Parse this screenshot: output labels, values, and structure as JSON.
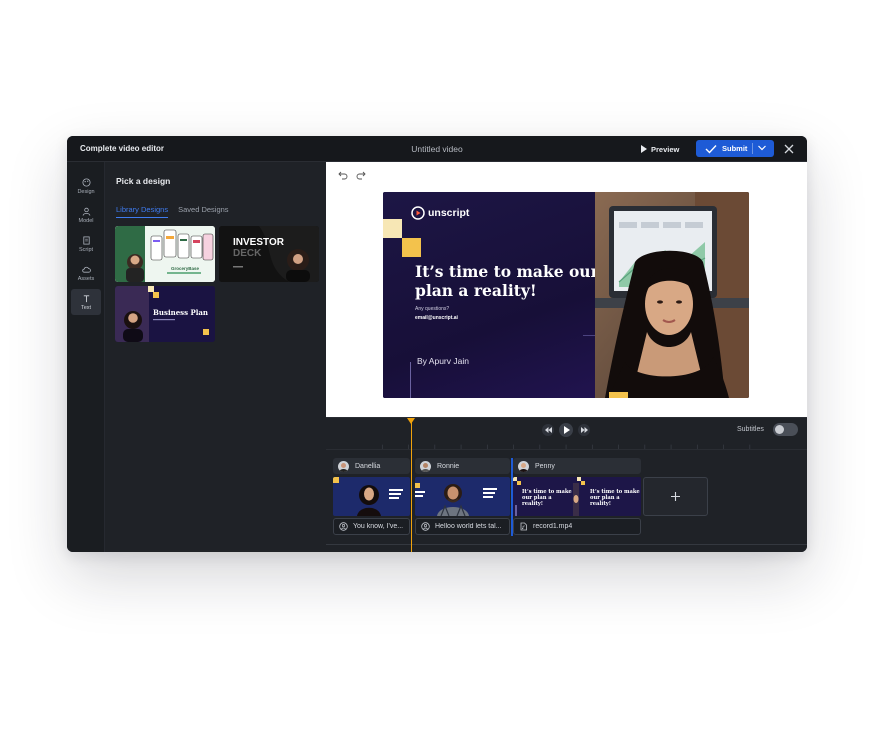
{
  "topbar": {
    "app_title": "Complete video editor",
    "doc_title": "Untitled video",
    "preview_label": "Preview",
    "submit_label": "Submit"
  },
  "rail": {
    "items": [
      {
        "label": "Design",
        "icon": "palette-icon"
      },
      {
        "label": "Model",
        "icon": "person-icon"
      },
      {
        "label": "Script",
        "icon": "document-icon"
      },
      {
        "label": "Assets",
        "icon": "cloud-icon"
      },
      {
        "label": "Text",
        "icon": "text-icon"
      }
    ],
    "active": "Text"
  },
  "panel": {
    "heading": "Pick a design",
    "tabs": [
      "Library Designs",
      "Saved Designs"
    ],
    "active_tab": "Library Designs",
    "thumbs": [
      {
        "title": "GroceryBase"
      },
      {
        "title": "INVESTOR",
        "title2": "DECK"
      },
      {
        "title": "Business Plan"
      }
    ]
  },
  "slide": {
    "brand": "unscript",
    "headline": "It’s time to make our plan a reality!",
    "question": "Any questions?",
    "email": "email@unscript.ai",
    "author": "By Apurv Jain",
    "mini_headline": "It’s time to make our plan a reality!"
  },
  "timeline": {
    "subtitles_label": "Subtitles",
    "tracks": [
      {
        "name": "Danellia",
        "audio": "You know, I've..."
      },
      {
        "name": "Ronnie",
        "audio": "Helloo world lets tal..."
      },
      {
        "name": "Penny",
        "audio": "record1.mp4"
      }
    ]
  },
  "colors": {
    "accent": "#1e5bd6",
    "playhead": "#f0a20c",
    "slide_bg": "#18123a",
    "slide_gold": "#f3c24c"
  }
}
